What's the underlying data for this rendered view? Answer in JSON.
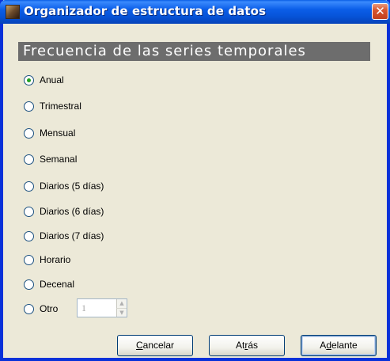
{
  "window": {
    "title": "Organizador de estructura de datos",
    "close_glyph": "✕"
  },
  "section": {
    "title": "Frecuencia de las series temporales"
  },
  "options": [
    {
      "label": "Anual",
      "selected": true
    },
    {
      "label": "Trimestral",
      "selected": false
    },
    {
      "label": "Mensual",
      "selected": false
    },
    {
      "label": "Semanal",
      "selected": false
    },
    {
      "label": "Diarios (5 días)",
      "selected": false
    },
    {
      "label": "Diarios (6 días)",
      "selected": false
    },
    {
      "label": "Diarios (7 días)",
      "selected": false
    },
    {
      "label": "Horario",
      "selected": false
    },
    {
      "label": "Decenal",
      "selected": false
    },
    {
      "label": "Otro",
      "selected": false
    }
  ],
  "other_spin": {
    "value": "1",
    "enabled": false
  },
  "buttons": {
    "cancel": {
      "pre": "",
      "mnemonic": "C",
      "post": "ancelar"
    },
    "back": {
      "pre": "At",
      "mnemonic": "r",
      "post": "ás"
    },
    "next": {
      "pre": "A",
      "mnemonic": "d",
      "post": "elante"
    }
  },
  "colors": {
    "title_bar": "#0653d7",
    "section_bg": "#6d6d6d",
    "radio_dot": "#21a121",
    "window_bg": "#ece9d8"
  }
}
